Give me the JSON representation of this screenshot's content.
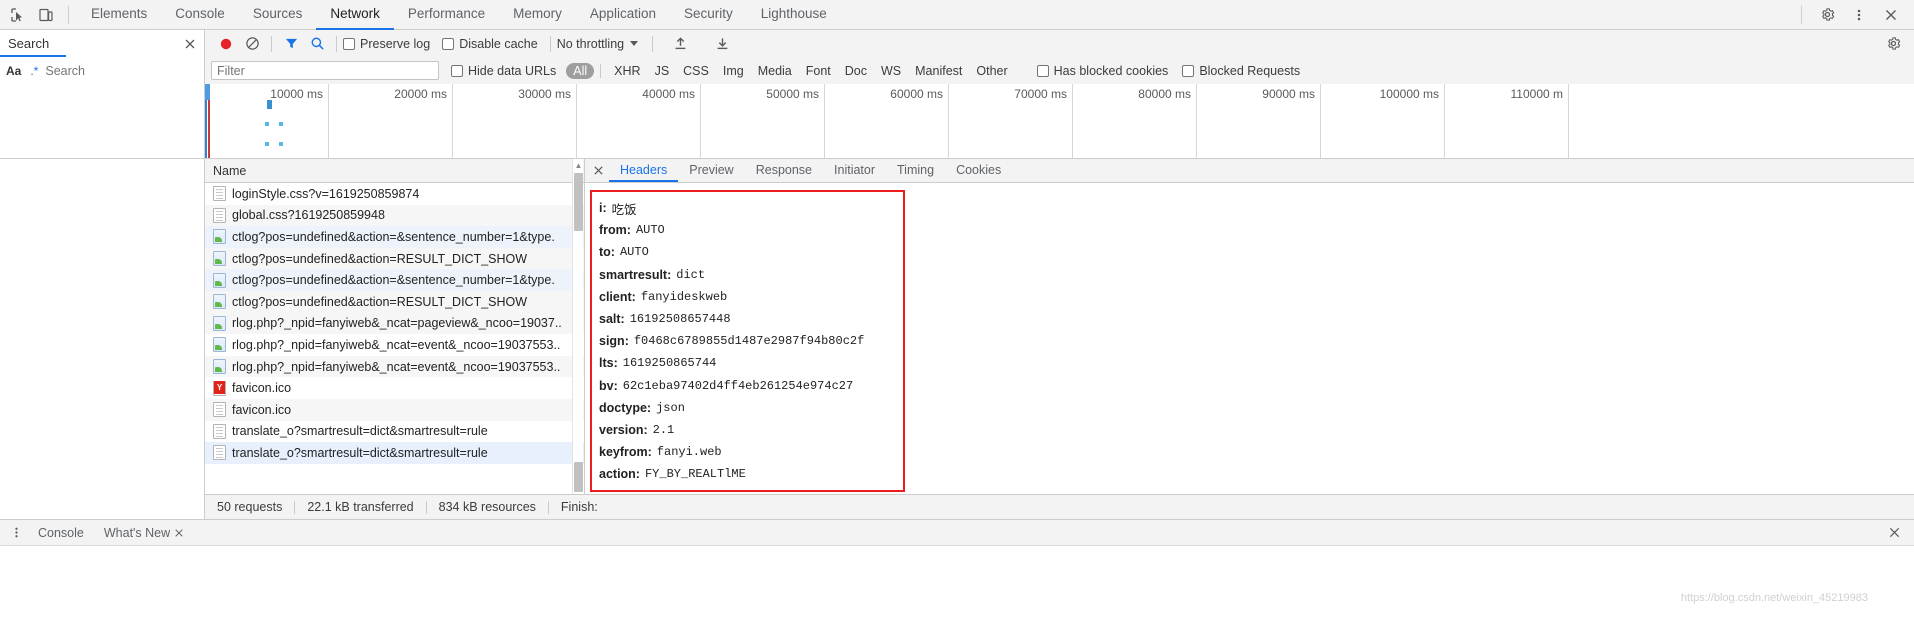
{
  "window": {
    "title": "Chrome DevTools - Network"
  },
  "tabbar": {
    "inspect_icon": "inspect-cursor-icon",
    "device_icon": "device-toolbar-icon",
    "tabs": [
      {
        "label": "Elements",
        "selected": false
      },
      {
        "label": "Console",
        "selected": false
      },
      {
        "label": "Sources",
        "selected": false
      },
      {
        "label": "Network",
        "selected": true
      },
      {
        "label": "Performance",
        "selected": false
      },
      {
        "label": "Memory",
        "selected": false
      },
      {
        "label": "Application",
        "selected": false
      },
      {
        "label": "Security",
        "selected": false
      },
      {
        "label": "Lighthouse",
        "selected": false
      }
    ],
    "settings_icon": "gear-icon",
    "more_icon": "kebab-menu-icon",
    "close_icon": "close-icon"
  },
  "search_panel": {
    "title": "Search",
    "close_icon": "close-icon",
    "match_case_label": "Aa",
    "regex_label": ".*",
    "input_placeholder": "Search",
    "input_value": "",
    "refresh_icon": "refresh-icon",
    "clear_icon": "clear-icon"
  },
  "network_toolbar": {
    "record_icon": "record-stop-icon",
    "clear_icon": "clear-icon",
    "filter_icon": "funnel-filter-icon",
    "search_icon": "search-icon",
    "preserve_log_label": "Preserve log",
    "preserve_log_checked": false,
    "disable_cache_label": "Disable cache",
    "disable_cache_checked": false,
    "throttling_label": "No throttling",
    "import_icon": "upload-har-icon",
    "export_icon": "download-har-icon",
    "settings_icon": "gear-icon"
  },
  "filter_bar": {
    "filter_placeholder": "Filter",
    "filter_value": "",
    "hide_data_urls_label": "Hide data URLs",
    "hide_data_urls_checked": false,
    "types": [
      {
        "label": "All",
        "active": true
      },
      {
        "label": "XHR",
        "active": false
      },
      {
        "label": "JS",
        "active": false
      },
      {
        "label": "CSS",
        "active": false
      },
      {
        "label": "Img",
        "active": false
      },
      {
        "label": "Media",
        "active": false
      },
      {
        "label": "Font",
        "active": false
      },
      {
        "label": "Doc",
        "active": false
      },
      {
        "label": "WS",
        "active": false
      },
      {
        "label": "Manifest",
        "active": false
      },
      {
        "label": "Other",
        "active": false
      }
    ],
    "has_blocked_cookies_label": "Has blocked cookies",
    "has_blocked_cookies_checked": false,
    "blocked_requests_label": "Blocked Requests",
    "blocked_requests_checked": false
  },
  "overview": {
    "ticks": [
      "10000 ms",
      "20000 ms",
      "30000 ms",
      "40000 ms",
      "50000 ms",
      "60000 ms",
      "70000 ms",
      "80000 ms",
      "90000 ms",
      "100000 ms",
      "110000 m"
    ],
    "tick_spacing_px": 124
  },
  "request_list": {
    "column_header": "Name",
    "rows": [
      {
        "name": "loginStyle.css?v=1619250859874",
        "icon": "css-file-icon",
        "selected": false
      },
      {
        "name": "global.css?1619250859948",
        "icon": "css-file-icon",
        "selected": false
      },
      {
        "name": "ctlog?pos=undefined&action=&sentence_number=1&type.",
        "icon": "xhr-file-icon",
        "selected": false
      },
      {
        "name": "ctlog?pos=undefined&action=RESULT_DICT_SHOW",
        "icon": "xhr-file-icon",
        "selected": false
      },
      {
        "name": "ctlog?pos=undefined&action=&sentence_number=1&type.",
        "icon": "xhr-file-icon",
        "selected": false
      },
      {
        "name": "ctlog?pos=undefined&action=RESULT_DICT_SHOW",
        "icon": "xhr-file-icon",
        "selected": false
      },
      {
        "name": "rlog.php?_npid=fanyiweb&_ncat=pageview&_ncoo=19037..",
        "icon": "xhr-file-icon",
        "selected": false
      },
      {
        "name": "rlog.php?_npid=fanyiweb&_ncat=event&_ncoo=19037553..",
        "icon": "xhr-file-icon",
        "selected": false
      },
      {
        "name": "rlog.php?_npid=fanyiweb&_ncat=event&_ncoo=19037553..",
        "icon": "xhr-file-icon",
        "selected": false
      },
      {
        "name": "favicon.ico",
        "icon": "favicon-icon",
        "selected": false
      },
      {
        "name": "favicon.ico",
        "icon": "doc-file-icon",
        "selected": false
      },
      {
        "name": "translate_o?smartresult=dict&smartresult=rule",
        "icon": "doc-file-icon",
        "selected": false
      },
      {
        "name": "translate_o?smartresult=dict&smartresult=rule",
        "icon": "doc-file-icon",
        "selected": true
      }
    ]
  },
  "detail_panel": {
    "close_icon": "close-icon",
    "tabs": [
      {
        "label": "Headers",
        "selected": true
      },
      {
        "label": "Preview",
        "selected": false
      },
      {
        "label": "Response",
        "selected": false
      },
      {
        "label": "Initiator",
        "selected": false
      },
      {
        "label": "Timing",
        "selected": false
      },
      {
        "label": "Cookies",
        "selected": false
      }
    ],
    "highlight_color": "#ee1c1c",
    "form_data": [
      {
        "key": "i:",
        "value": "吃饭",
        "cjk": true
      },
      {
        "key": "from:",
        "value": "AUTO",
        "cjk": false
      },
      {
        "key": "to:",
        "value": "AUTO",
        "cjk": false
      },
      {
        "key": "smartresult:",
        "value": "dict",
        "cjk": false
      },
      {
        "key": "client:",
        "value": "fanyideskweb",
        "cjk": false
      },
      {
        "key": "salt:",
        "value": "16192508657448",
        "cjk": false
      },
      {
        "key": "sign:",
        "value": "f0468c6789855d1487e2987f94b80c2f",
        "cjk": false
      },
      {
        "key": "lts:",
        "value": "1619250865744",
        "cjk": false
      },
      {
        "key": "bv:",
        "value": "62c1eba97402d4ff4eb261254e974c27",
        "cjk": false
      },
      {
        "key": "doctype:",
        "value": "json",
        "cjk": false
      },
      {
        "key": "version:",
        "value": "2.1",
        "cjk": false
      },
      {
        "key": "keyfrom:",
        "value": "fanyi.web",
        "cjk": false
      },
      {
        "key": "action:",
        "value": "FY_BY_REALTlME",
        "cjk": false
      }
    ]
  },
  "status_bar": {
    "requests": "50 requests",
    "transferred": "22.1 kB transferred",
    "resources": "834 kB resources",
    "finish": "Finish:"
  },
  "drawer": {
    "menu_icon": "kebab-menu-icon",
    "tabs": [
      {
        "label": "Console",
        "selected": false,
        "closeable": false
      },
      {
        "label": "What's New",
        "selected": false,
        "closeable": true
      }
    ],
    "close_icon": "close-icon"
  },
  "watermark": "https://blog.csdn.net/weixin_45219983"
}
